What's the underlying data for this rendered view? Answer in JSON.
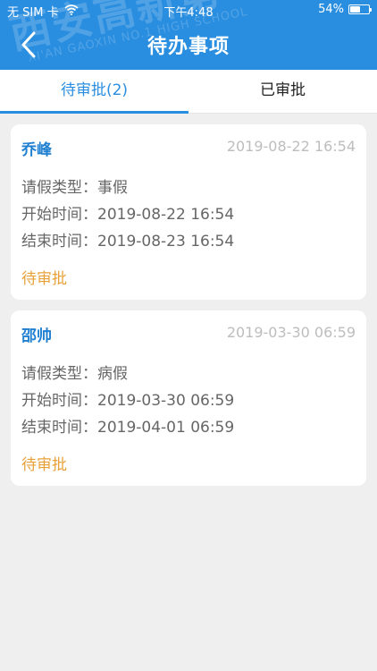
{
  "status_bar": {
    "carrier": "无 SIM 卡",
    "time": "下午4:48",
    "battery_text": "54%",
    "battery_level": 0.54
  },
  "header": {
    "title": "待办事项",
    "watermark_cn": "西安高新第一中学",
    "watermark_en": "XI'AN GAOXIN NO.1 HIGH SCHOOL"
  },
  "tabs": [
    {
      "label": "待审批(2)",
      "active": true
    },
    {
      "label": "已审批",
      "active": false
    }
  ],
  "cards": [
    {
      "name": "乔峰",
      "submitted": "2019-08-22 16:54",
      "type_label": "请假类型：",
      "type_value": "事假",
      "start_label": "开始时间：",
      "start_value": "2019-08-22 16:54",
      "end_label": "结束时间：",
      "end_value": "2019-08-23 16:54",
      "status": "待审批"
    },
    {
      "name": "邵帅",
      "submitted": "2019-03-30 06:59",
      "type_label": "请假类型：",
      "type_value": "病假",
      "start_label": "开始时间：",
      "start_value": "2019-03-30 06:59",
      "end_label": "结束时间：",
      "end_value": "2019-04-01 06:59",
      "status": "待审批"
    }
  ],
  "colors": {
    "primary": "#2a8ee0",
    "name": "#1f7fd1",
    "pending": "#e8a13a",
    "background": "#efefef"
  }
}
